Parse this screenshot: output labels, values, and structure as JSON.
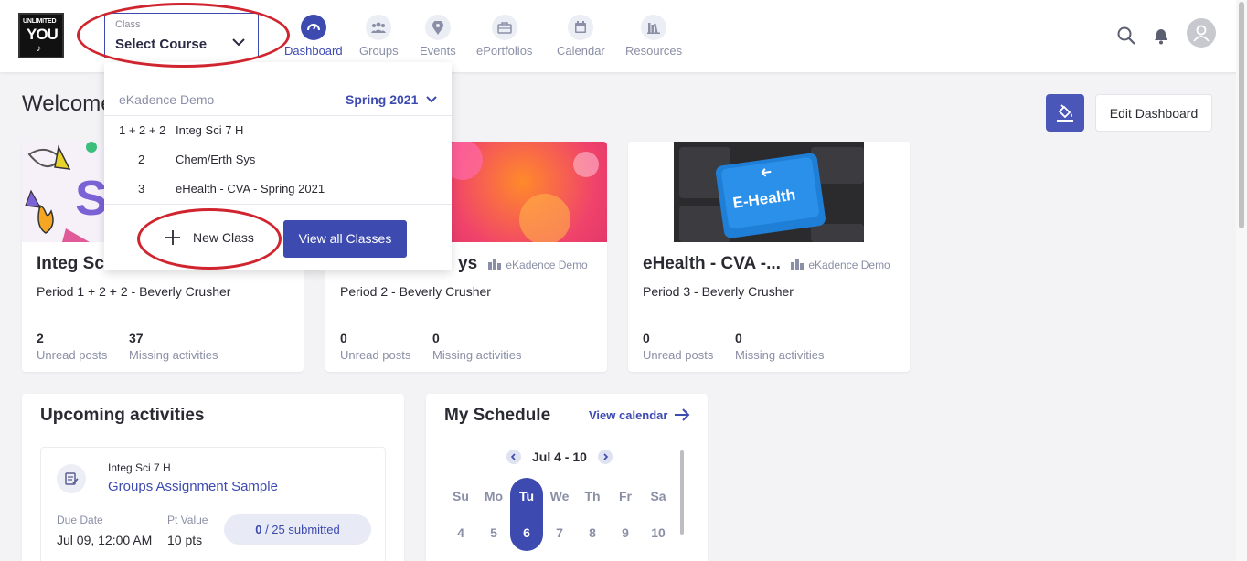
{
  "logo": {
    "line1": "UNLIMITED",
    "line2": "YOU",
    "line3": "♪"
  },
  "class_select": {
    "label": "Class",
    "value": "Select Course"
  },
  "nav": [
    {
      "label": "Dashboard",
      "icon": "gauge-icon",
      "active": true
    },
    {
      "label": "Groups",
      "icon": "users-icon",
      "active": false
    },
    {
      "label": "Events",
      "icon": "map-pin-icon",
      "active": false
    },
    {
      "label": "ePortfolios",
      "icon": "briefcase-icon",
      "active": false
    },
    {
      "label": "Calendar",
      "icon": "calendar-icon",
      "active": false
    },
    {
      "label": "Resources",
      "icon": "library-icon",
      "active": false
    }
  ],
  "welcome": "Welcome",
  "edit_dashboard": "Edit Dashboard",
  "dropdown": {
    "org": "eKadence Demo",
    "term": "Spring 2021",
    "classes": [
      {
        "period": "1 + 2 + 2",
        "name": "Integ Sci 7 H"
      },
      {
        "period": "2",
        "name": "Chem/Erth Sys"
      },
      {
        "period": "3",
        "name": "eHealth - CVA - Spring 2021"
      }
    ],
    "new_class": "New Class",
    "view_all": "View all Classes"
  },
  "cards": [
    {
      "title": "Integ Sc",
      "org": "",
      "period": "Period 1 + 2 + 2 - Beverly Crusher",
      "unread": "2",
      "unread_label": "Unread posts",
      "missing": "37",
      "missing_label": "Missing activities"
    },
    {
      "title": "ys",
      "org": "eKadence Demo",
      "period": "Period 2 - Beverly Crusher",
      "unread": "0",
      "unread_label": "Unread posts",
      "missing": "0",
      "missing_label": "Missing activities"
    },
    {
      "title": "eHealth - CVA -...",
      "org": "eKadence Demo",
      "period": "Period 3 - Beverly Crusher",
      "unread": "0",
      "unread_label": "Unread posts",
      "missing": "0",
      "missing_label": "Missing activities",
      "image_text": "E-Health"
    }
  ],
  "upcoming": {
    "title": "Upcoming activities",
    "item": {
      "class": "Integ Sci 7 H",
      "name": "Groups Assignment Sample",
      "due_label": "Due Date",
      "due_value": "Jul 09, 12:00 AM",
      "pt_label": "Pt Value",
      "pt_value": "10 pts",
      "submitted_count": "0",
      "submitted_rest": " / 25 submitted"
    }
  },
  "schedule": {
    "title": "My Schedule",
    "view_calendar": "View calendar",
    "week": "Jul 4 - 10",
    "days": [
      {
        "name": "Su",
        "date": "4",
        "selected": false
      },
      {
        "name": "Mo",
        "date": "5",
        "selected": false
      },
      {
        "name": "Tu",
        "date": "6",
        "selected": true
      },
      {
        "name": "We",
        "date": "7",
        "selected": false
      },
      {
        "name": "Th",
        "date": "8",
        "selected": false
      },
      {
        "name": "Fr",
        "date": "9",
        "selected": false
      },
      {
        "name": "Sa",
        "date": "10",
        "selected": false
      }
    ]
  },
  "colors": {
    "accent": "#3d4ab0",
    "annotation": "#d0252e",
    "background": "#f3f3f5"
  }
}
